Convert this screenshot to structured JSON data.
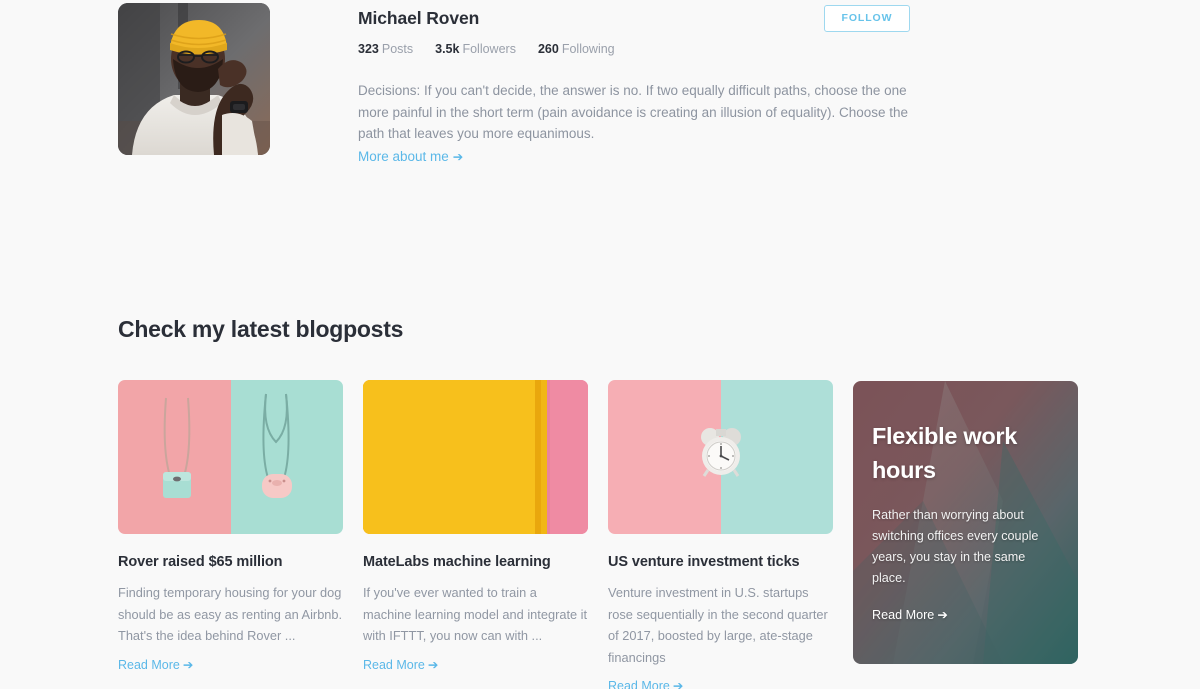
{
  "profile": {
    "name": "Michael Roven",
    "avatar_alt": "avatar-photo",
    "stats": [
      {
        "value": "323",
        "label": "Posts"
      },
      {
        "value": "3.5k",
        "label": "Followers"
      },
      {
        "value": "260",
        "label": "Following"
      }
    ],
    "bio": "Decisions: If you can't decide, the answer is no. If two equally difficult paths, choose the one more painful in the short term (pain avoidance is creating an illusion of equality). Choose the path that leaves you more equanimous.",
    "more_link": "More about me",
    "arrow": "➔",
    "follow_label": "FOLLOW"
  },
  "section": {
    "title": "Check my latest blogposts"
  },
  "posts": [
    {
      "title": "Rover raised $65 million",
      "excerpt": "Finding temporary housing for your dog should be as easy as renting an Airbnb. That's the idea behind Rover ...",
      "read_more": "Read More",
      "arrow": "➔",
      "thumb_name": "handbags-photo"
    },
    {
      "title": "MateLabs machine learning",
      "excerpt": "If you've ever wanted to train a machine learning model and integrate it with IFTTT, you now can with ...",
      "read_more": "Read More",
      "arrow": "➔",
      "thumb_name": "yellow-notebook-photo"
    },
    {
      "title": "US venture investment ticks",
      "excerpt": "Venture investment in U.S. startups rose sequentially in the second quarter of 2017, boosted by large, ate-stage financings",
      "read_more": "Read More",
      "arrow": "➔",
      "thumb_name": "alarm-clock-photo"
    }
  ],
  "promo": {
    "title": "Flexible work hours",
    "text": "Rather than worrying about switching offices every couple years, you stay in the same place.",
    "read_more": "Read More",
    "arrow": "➔",
    "bg_name": "mountain-gradient-photo"
  },
  "colors": {
    "page_bg": "#f9f9f9",
    "text_dark": "#2b2f38",
    "text_muted": "#9097a3",
    "link_blue": "#5bb8e8",
    "follow_border": "#9ed8ef"
  }
}
